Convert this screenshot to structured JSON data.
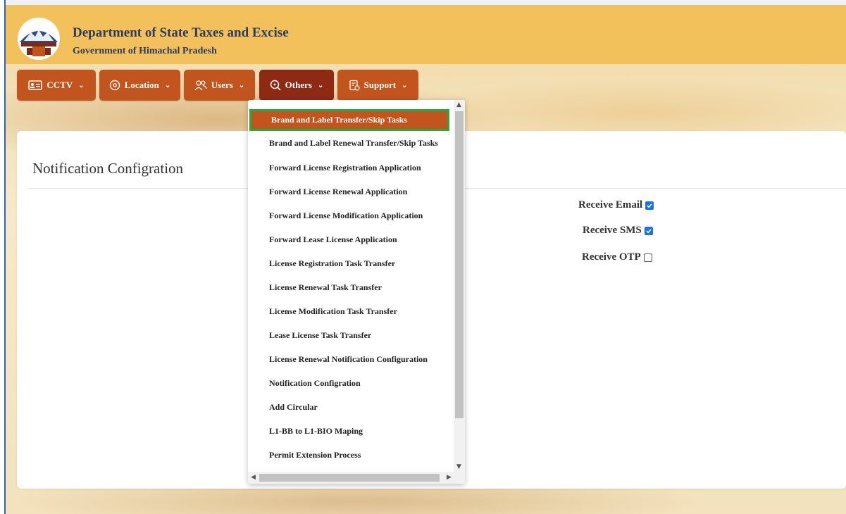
{
  "header": {
    "title": "Department of State Taxes and Excise",
    "subtitle": "Government of Himachal Pradesh",
    "colors": {
      "header_bg": "#f3c15c",
      "title": "#2a3b5f"
    }
  },
  "nav": {
    "items": [
      {
        "label": "CCTV",
        "icon": "id-card-icon"
      },
      {
        "label": "Location",
        "icon": "location-pin-icon"
      },
      {
        "label": "Users",
        "icon": "users-icon"
      },
      {
        "label": "Others",
        "icon": "search-icon",
        "active": true
      },
      {
        "label": "Support",
        "icon": "support-icon"
      }
    ],
    "colors": {
      "button": "#c2541e",
      "active": "#8e2a14"
    }
  },
  "card": {
    "title": "Notification Configration",
    "options": [
      {
        "label": "Receive Email",
        "checked": true
      },
      {
        "label": "Receive SMS",
        "checked": true
      },
      {
        "label": "Receive OTP",
        "checked": false
      }
    ]
  },
  "dropdown": {
    "items": [
      "Brand and Label Transfer/Skip Tasks",
      "Brand and Label Renewal Transfer/Skip Tasks",
      "Forward License Registration Application",
      "Forward License Renewal Application",
      "Forward License Modification Application",
      "Forward Lease License Application",
      "License Registration Task Transfer",
      "License Renewal Task Transfer",
      "License Modification Task Transfer",
      "Lease License Task Transfer",
      "License Renewal Notification Configuration",
      "Notification Configration",
      "Add Circular",
      "L1-BB to L1-BIO Maping",
      "Permit Extension Process"
    ],
    "highlighted_index": 0,
    "colors": {
      "highlight_bg": "#c2541e",
      "highlight_border": "#2aa63c"
    }
  }
}
